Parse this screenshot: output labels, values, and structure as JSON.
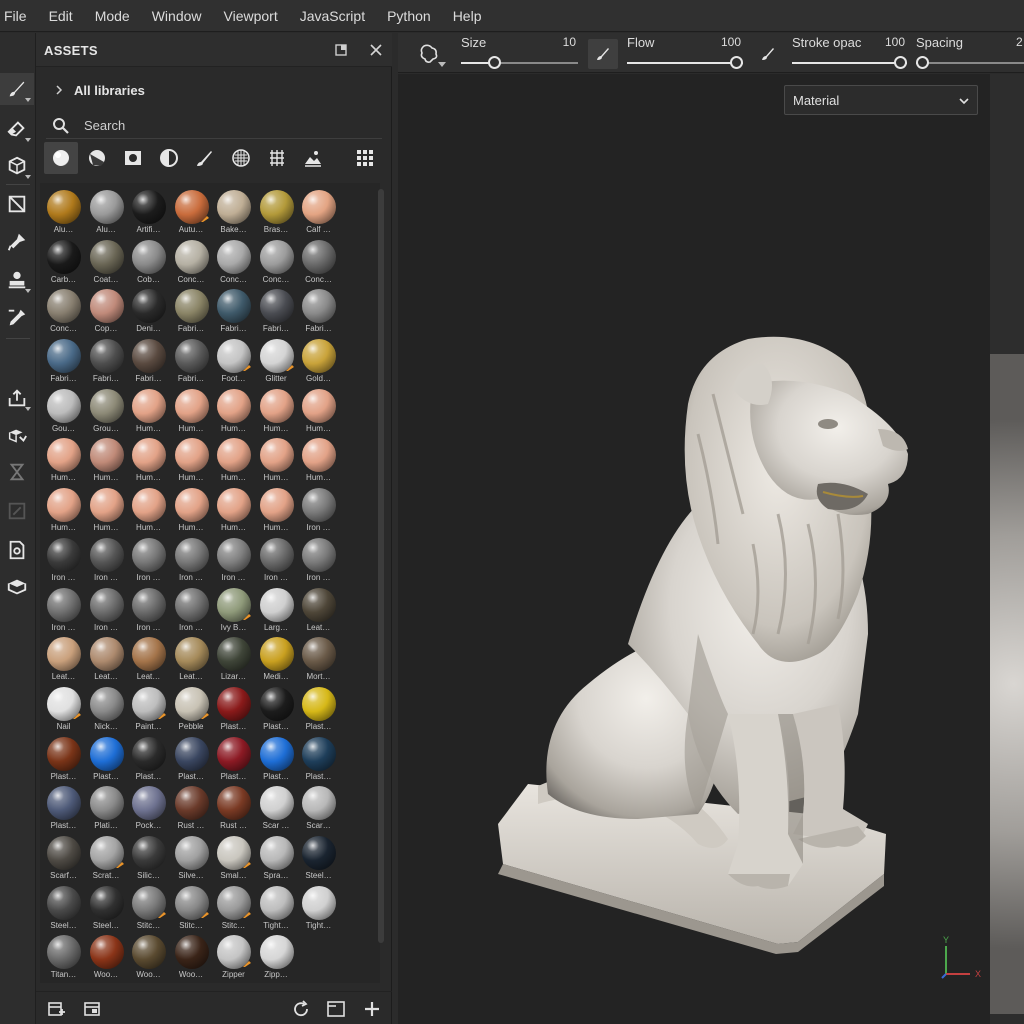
{
  "menu": [
    "File",
    "Edit",
    "Mode",
    "Window",
    "Viewport",
    "JavaScript",
    "Python",
    "Help"
  ],
  "toolbar": {
    "tools": [
      "paint-brush-icon",
      "eraser-icon",
      "projection-icon",
      "polygon-fill-icon",
      "smudge-icon",
      "clone-stamp-icon",
      "color-picker-icon",
      "export-icon",
      "bake-icon",
      "hourglass-icon",
      "layout-icon",
      "iray-icon",
      "3d-cube-icon"
    ]
  },
  "assets": {
    "title": "ASSETS",
    "libraries_label": "All libraries",
    "search_placeholder": "Search",
    "filters": [
      "materials-filter-icon",
      "smart-materials-filter-icon",
      "alphas-filter-icon",
      "filters-filter-icon",
      "brushes-filter-icon",
      "textures-filter-icon",
      "grid-filter-icon",
      "environments-filter-icon"
    ],
    "items": [
      {
        "label": "Alu…",
        "color": "#b07a1c",
        "badge": false
      },
      {
        "label": "Alu…",
        "color": "#9a9a9a",
        "badge": false
      },
      {
        "label": "Artifi…",
        "color": "#1c1c1c",
        "badge": false
      },
      {
        "label": "Autu…",
        "color": "#c96c3c",
        "badge": true
      },
      {
        "label": "Bake…",
        "color": "#bfae95",
        "badge": false
      },
      {
        "label": "Bras…",
        "color": "#b39a3a",
        "badge": false
      },
      {
        "label": "Calf …",
        "color": "#e3a483",
        "badge": false
      },
      {
        "label": "Carb…",
        "color": "#1a1a1a",
        "badge": false
      },
      {
        "label": "Coat…",
        "color": "#6a6655",
        "badge": false
      },
      {
        "label": "Cob…",
        "color": "#8a8a8a",
        "badge": false
      },
      {
        "label": "Conc…",
        "color": "#b5b0a3",
        "badge": false
      },
      {
        "label": "Conc…",
        "color": "#a9a9a9",
        "badge": false
      },
      {
        "label": "Conc…",
        "color": "#9c9c9c",
        "badge": false
      },
      {
        "label": "Conc…",
        "color": "#6a6a6a",
        "badge": false
      },
      {
        "label": "Conc…",
        "color": "#887f70",
        "badge": false
      },
      {
        "label": "Cop…",
        "color": "#c08a7a",
        "badge": false
      },
      {
        "label": "Deni…",
        "color": "#2a2a2a",
        "badge": false
      },
      {
        "label": "Fabri…",
        "color": "#8a8466",
        "badge": false
      },
      {
        "label": "Fabri…",
        "color": "#3f5a6a",
        "badge": false
      },
      {
        "label": "Fabri…",
        "color": "#4a4c52",
        "badge": false
      },
      {
        "label": "Fabri…",
        "color": "#8a8a8a",
        "badge": false
      },
      {
        "label": "Fabri…",
        "color": "#4a6a88",
        "badge": false
      },
      {
        "label": "Fabri…",
        "color": "#4e4e4e",
        "badge": false
      },
      {
        "label": "Fabri…",
        "color": "#5a4a40",
        "badge": false
      },
      {
        "label": "Fabri…",
        "color": "#5a5a5a",
        "badge": false
      },
      {
        "label": "Foot…",
        "color": "#c4c4c4",
        "badge": true
      },
      {
        "label": "Glitter",
        "color": "#d4d4d4",
        "badge": true
      },
      {
        "label": "Gold…",
        "color": "#c9a33a",
        "badge": false
      },
      {
        "label": "Gou…",
        "color": "#bcbcbc",
        "badge": false
      },
      {
        "label": "Grou…",
        "color": "#8d8a77",
        "badge": false
      },
      {
        "label": "Hum…",
        "color": "#e2a287",
        "badge": false
      },
      {
        "label": "Hum…",
        "color": "#e2a287",
        "badge": false
      },
      {
        "label": "Hum…",
        "color": "#e2a287",
        "badge": false
      },
      {
        "label": "Hum…",
        "color": "#e2a287",
        "badge": false
      },
      {
        "label": "Hum…",
        "color": "#e2a287",
        "badge": false
      },
      {
        "label": "Hum…",
        "color": "#e2a287",
        "badge": false
      },
      {
        "label": "Hum…",
        "color": "#c08a78",
        "badge": false
      },
      {
        "label": "Hum…",
        "color": "#e2a287",
        "badge": false
      },
      {
        "label": "Hum…",
        "color": "#e2a287",
        "badge": false
      },
      {
        "label": "Hum…",
        "color": "#e2a287",
        "badge": false
      },
      {
        "label": "Hum…",
        "color": "#e2a287",
        "badge": false
      },
      {
        "label": "Hum…",
        "color": "#e2a287",
        "badge": false
      },
      {
        "label": "Hum…",
        "color": "#e2a287",
        "badge": false
      },
      {
        "label": "Hum…",
        "color": "#e2a287",
        "badge": false
      },
      {
        "label": "Hum…",
        "color": "#e2a287",
        "badge": false
      },
      {
        "label": "Hum…",
        "color": "#e2a287",
        "badge": false
      },
      {
        "label": "Hum…",
        "color": "#e2a287",
        "badge": false
      },
      {
        "label": "Hum…",
        "color": "#e2a287",
        "badge": false
      },
      {
        "label": "Iron …",
        "color": "#7a7a7a",
        "badge": false
      },
      {
        "label": "Iron …",
        "color": "#3a3a3a",
        "badge": false
      },
      {
        "label": "Iron …",
        "color": "#555555",
        "badge": false
      },
      {
        "label": "Iron …",
        "color": "#777777",
        "badge": false
      },
      {
        "label": "Iron …",
        "color": "#777777",
        "badge": false
      },
      {
        "label": "Iron …",
        "color": "#808080",
        "badge": false
      },
      {
        "label": "Iron …",
        "color": "#6a6a6a",
        "badge": false
      },
      {
        "label": "Iron …",
        "color": "#7a7a7a",
        "badge": false
      },
      {
        "label": "Iron …",
        "color": "#707070",
        "badge": false
      },
      {
        "label": "Iron …",
        "color": "#6c6c6c",
        "badge": false
      },
      {
        "label": "Iron …",
        "color": "#6a6a6a",
        "badge": false
      },
      {
        "label": "Iron …",
        "color": "#707070",
        "badge": false
      },
      {
        "label": "Ivy B…",
        "color": "#8f9a7a",
        "badge": true
      },
      {
        "label": "Larg…",
        "color": "#cfcfcf",
        "badge": false
      },
      {
        "label": "Leat…",
        "color": "#4e4638",
        "badge": false
      },
      {
        "label": "Leat…",
        "color": "#c9a07c",
        "badge": false
      },
      {
        "label": "Leat…",
        "color": "#ad8a6e",
        "badge": false
      },
      {
        "label": "Leat…",
        "color": "#a4744a",
        "badge": false
      },
      {
        "label": "Leat…",
        "color": "#a58a5a",
        "badge": false
      },
      {
        "label": "Lizar…",
        "color": "#3f4538",
        "badge": false
      },
      {
        "label": "Medi…",
        "color": "#c9a020",
        "badge": false
      },
      {
        "label": "Mort…",
        "color": "#6a5a48",
        "badge": false
      },
      {
        "label": "Nail",
        "color": "#e0e0e0",
        "badge": true
      },
      {
        "label": "Nick…",
        "color": "#8a8a8a",
        "badge": false
      },
      {
        "label": "Paint…",
        "color": "#bdbdbd",
        "badge": true
      },
      {
        "label": "Pebble",
        "color": "#c8c2b4",
        "badge": true
      },
      {
        "label": "Plast…",
        "color": "#8a1a1a",
        "badge": false
      },
      {
        "label": "Plast…",
        "color": "#1c1c1c",
        "badge": false
      },
      {
        "label": "Plast…",
        "color": "#d6b818",
        "badge": false
      },
      {
        "label": "Plast…",
        "color": "#7a3418",
        "badge": false
      },
      {
        "label": "Plast…",
        "color": "#1e6ed6",
        "badge": false
      },
      {
        "label": "Plast…",
        "color": "#2a2a2a",
        "badge": false
      },
      {
        "label": "Plast…",
        "color": "#3a4660",
        "badge": false
      },
      {
        "label": "Plast…",
        "color": "#8c1a24",
        "badge": false
      },
      {
        "label": "Plast…",
        "color": "#1e6ed6",
        "badge": false
      },
      {
        "label": "Plast…",
        "color": "#1e3e5a",
        "badge": false
      },
      {
        "label": "Plast…",
        "color": "#4e5a78",
        "badge": false
      },
      {
        "label": "Plati…",
        "color": "#8a8a8a",
        "badge": false
      },
      {
        "label": "Pock…",
        "color": "#6e7290",
        "badge": false
      },
      {
        "label": "Rust …",
        "color": "#6a3a2a",
        "badge": false
      },
      {
        "label": "Rust …",
        "color": "#7a3a24",
        "badge": false
      },
      {
        "label": "Scar …",
        "color": "#d0d0d0",
        "badge": false
      },
      {
        "label": "Scar…",
        "color": "#b8b8b8",
        "badge": false
      },
      {
        "label": "Scarf…",
        "color": "#4e4a44",
        "badge": false
      },
      {
        "label": "Scrat…",
        "color": "#a4a4a4",
        "badge": true
      },
      {
        "label": "Silic…",
        "color": "#3a3a3a",
        "badge": false
      },
      {
        "label": "Silve…",
        "color": "#a0a0a0",
        "badge": false
      },
      {
        "label": "Smal…",
        "color": "#c9c6be",
        "badge": true
      },
      {
        "label": "Spra…",
        "color": "#b8b8b8",
        "badge": false
      },
      {
        "label": "Steel…",
        "color": "#1a2430",
        "badge": false
      },
      {
        "label": "Steel…",
        "color": "#4a4a4a",
        "badge": false
      },
      {
        "label": "Steel…",
        "color": "#303030",
        "badge": false
      },
      {
        "label": "Stitc…",
        "color": "#7a7a7a",
        "badge": true
      },
      {
        "label": "Stitc…",
        "color": "#888888",
        "badge": true
      },
      {
        "label": "Stitc…",
        "color": "#9a9a9a",
        "badge": true
      },
      {
        "label": "Tight…",
        "color": "#bdbdbd",
        "badge": false
      },
      {
        "label": "Tight…",
        "color": "#d0d0d0",
        "badge": false
      },
      {
        "label": "Titan…",
        "color": "#6a6a6a",
        "badge": false
      },
      {
        "label": "Woo…",
        "color": "#8a3418",
        "badge": false
      },
      {
        "label": "Woo…",
        "color": "#5a4a30",
        "badge": false
      },
      {
        "label": "Woo…",
        "color": "#3a2418",
        "badge": false
      },
      {
        "label": "Zipper",
        "color": "#c4c4c4",
        "badge": true
      },
      {
        "label": "Zipp…",
        "color": "#d6d6d6",
        "badge": false
      }
    ]
  },
  "brush": {
    "size": {
      "label": "Size",
      "value": "10",
      "fraction": 0.28
    },
    "flow": {
      "label": "Flow",
      "value": "100",
      "fraction": 1.0
    },
    "stroke_opacity": {
      "label": "Stroke opac",
      "value": "100",
      "fraction": 1.0
    },
    "spacing": {
      "label": "Spacing",
      "value": "2",
      "fraction": 0.02
    }
  },
  "viewport": {
    "channel_dropdown": "Material",
    "gizmo_axes": {
      "y": "Y",
      "x": "X"
    }
  },
  "colors": {
    "accent_badge": "#e8932a",
    "gizmo_y": "#4ca84c",
    "gizmo_x": "#c44040",
    "gizmo_z": "#3a6ad6"
  }
}
